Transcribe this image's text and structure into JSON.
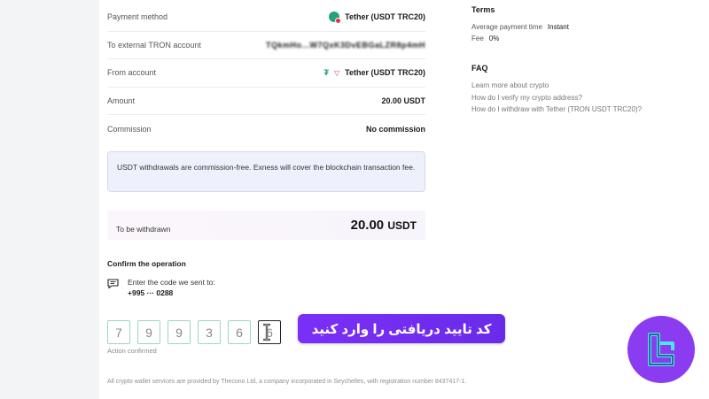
{
  "details": [
    {
      "label": "Payment method",
      "value": "Tether (USDT TRC20)",
      "icon": "tether-coin-icon"
    },
    {
      "label": "To external TRON account",
      "value": "TQkmHo...W7QxK3DvEBGaLZR8p4mH",
      "blurred": true
    },
    {
      "label": "From account",
      "value": "Tether (USDT TRC20)",
      "icon": "tether-tron-icons"
    },
    {
      "label": "Amount",
      "value": "20.00 USDT"
    },
    {
      "label": "Commission",
      "value": "No commission"
    }
  ],
  "notice": "USDT withdrawals are commission-free. Exness will cover the blockchain transaction fee.",
  "withdraw": {
    "label": "To be withdrawn",
    "amount": "20.00",
    "currency": "USDT"
  },
  "confirm": {
    "title": "Confirm the operation",
    "sms_text": "Enter the code we sent to:",
    "phone": "+995 ··· 0288",
    "digits": [
      "7",
      "9",
      "9",
      "3",
      "6",
      "6"
    ],
    "status": "Action confirmed"
  },
  "overlay_button": "کد تایید دریافتی را وارد کنید",
  "footer": "All crypto wallet services are provided by Thecono Ltd, a company incorporated in Seychelles, with registration number 8437417-1.",
  "terms": {
    "title": "Terms",
    "items": [
      {
        "label": "Average payment time",
        "value": "Instant"
      },
      {
        "label": "Fee",
        "value": "0%"
      }
    ]
  },
  "faq": {
    "title": "FAQ",
    "links": [
      "Learn more about crypto",
      "How do I verify my crypto address?",
      "How do I withdraw with Tether (TRON USDT TRC20)?"
    ]
  },
  "colors": {
    "accent": "#7b2ff7",
    "tether": "#26a17b",
    "tron": "#e0314c",
    "logo_bg": "#8b3cf0"
  }
}
